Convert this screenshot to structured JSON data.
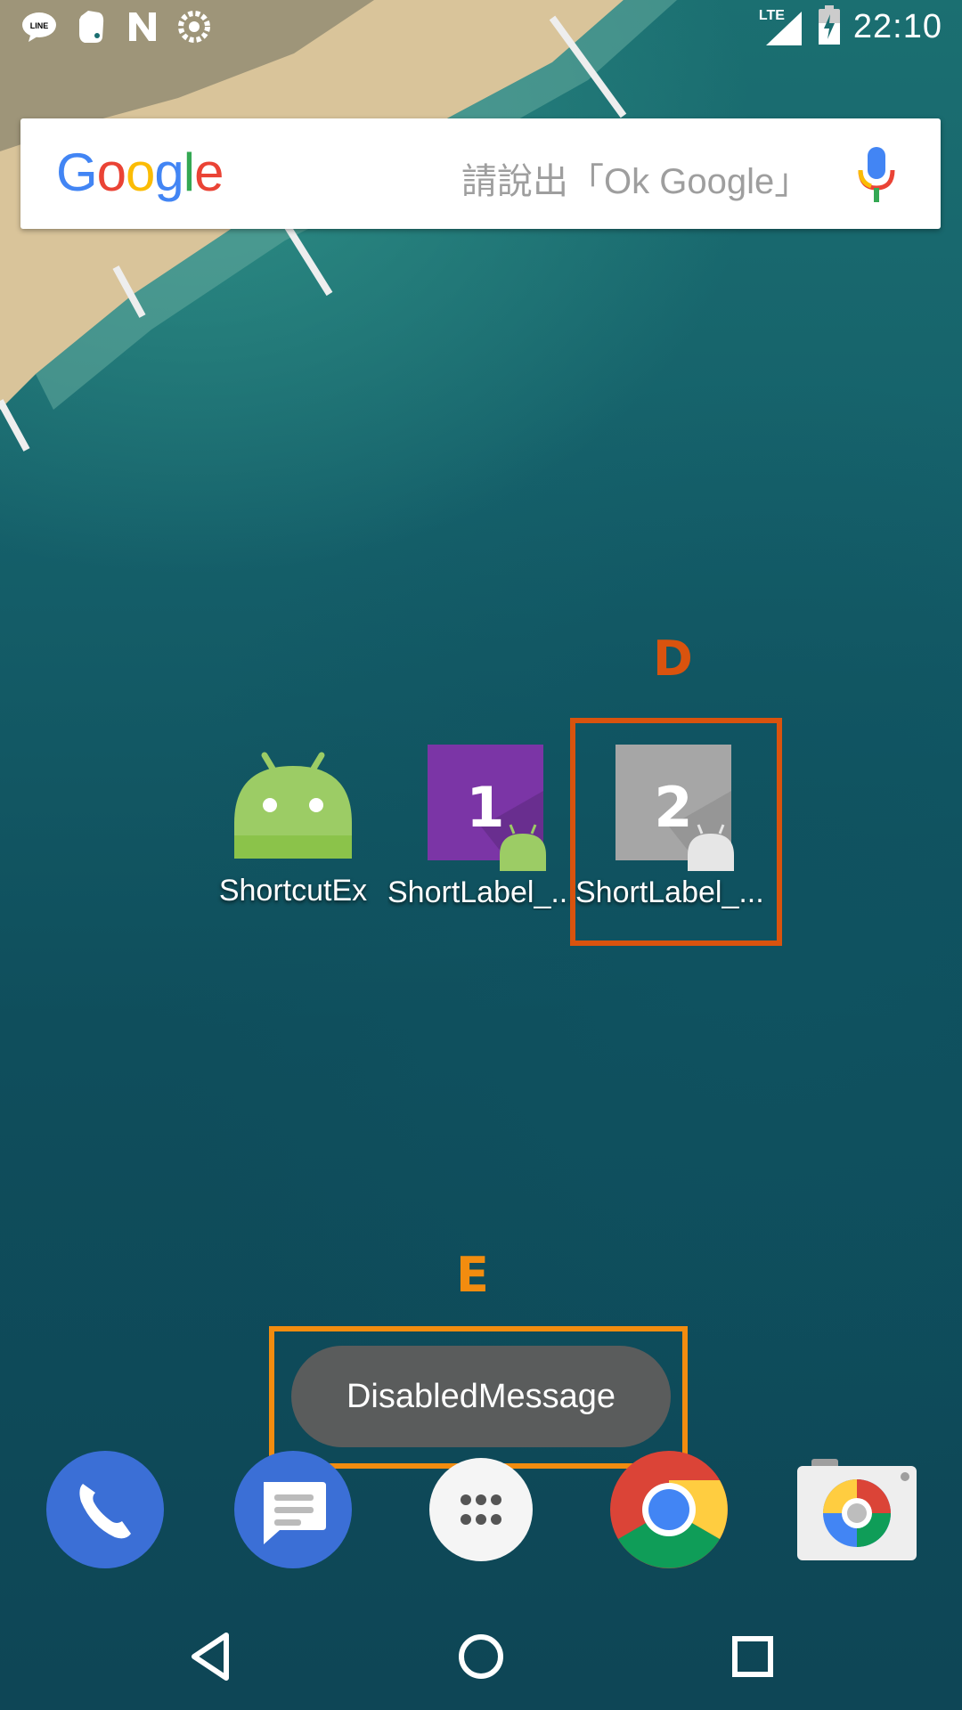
{
  "status_bar": {
    "network": "LTE",
    "time": "22:10",
    "notification_icons": [
      "line-icon",
      "evernote-icon",
      "n-icon",
      "settings-gear-icon"
    ]
  },
  "search_bar": {
    "logo": "Google",
    "hint": "請說出「Ok Google」"
  },
  "home_icons": [
    {
      "label": "ShortcutEx",
      "icon": "android-icon"
    },
    {
      "label": "ShortLabel_...",
      "icon": "shortcut-1-icon",
      "number": "1",
      "color": "#7b35a6"
    },
    {
      "label": "ShortLabel_...",
      "icon": "shortcut-2-disabled-icon",
      "number": "2",
      "color": "#a6a6a6"
    }
  ],
  "annotations": {
    "D": {
      "letter": "D",
      "color": "#d9530e"
    },
    "E": {
      "letter": "E",
      "color": "#f28c0f"
    }
  },
  "toast": {
    "message": "DisabledMessage"
  },
  "dock": [
    "phone-icon",
    "messages-icon",
    "app-drawer-icon",
    "chrome-icon",
    "camera-icon"
  ],
  "nav": [
    "back-button",
    "home-button",
    "recents-button"
  ]
}
